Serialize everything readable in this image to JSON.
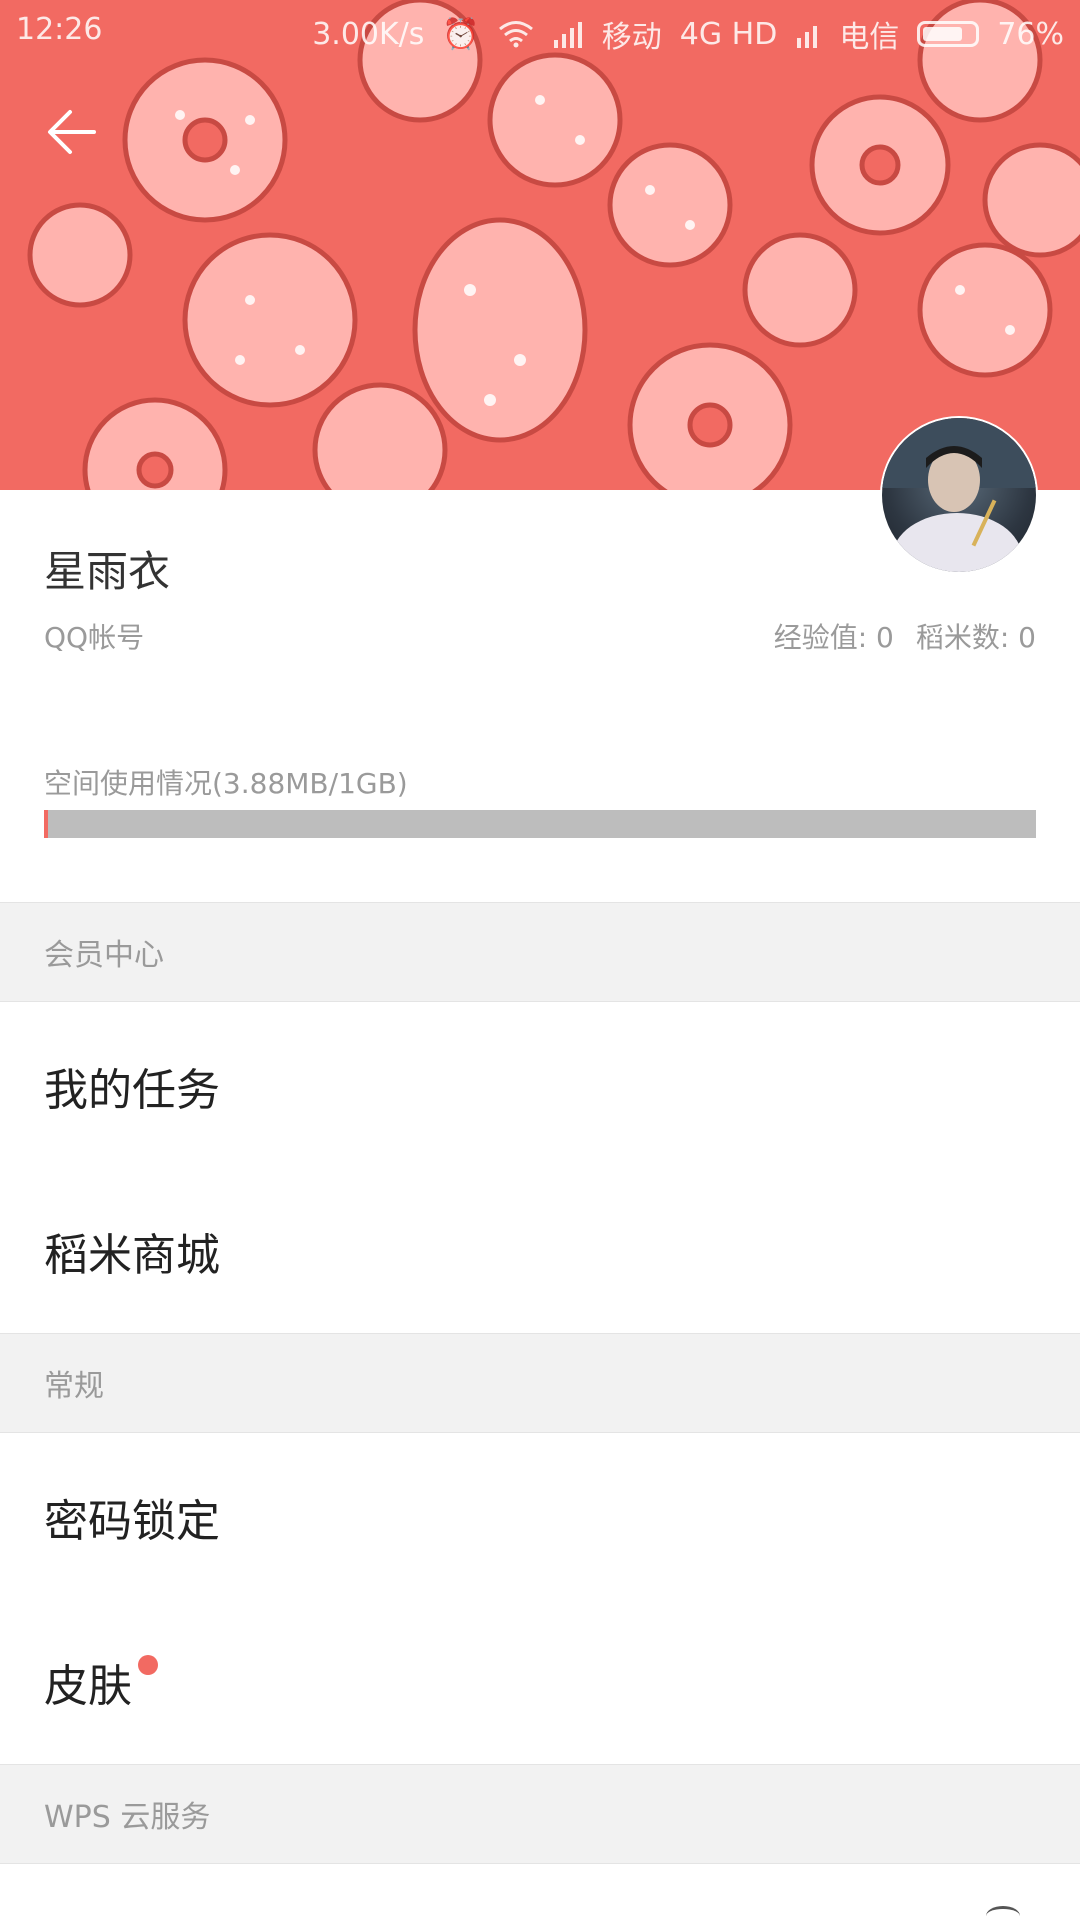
{
  "status_bar": {
    "time": "12:26",
    "speed": "3.00K/s",
    "carrier1": "移动",
    "network": "4G HD",
    "carrier2": "电信",
    "battery": "76%",
    "battery_level": 0.76
  },
  "header": {
    "back_icon": "arrow-left-icon",
    "accent_color": "#f26a62"
  },
  "profile": {
    "username": "星雨衣",
    "account_label": "QQ帐号",
    "experience": "经验值: 0",
    "rice_count": "稻米数: 0",
    "storage_label": "空间使用情况(3.88MB/1GB)",
    "storage_used_fraction": 0.0038
  },
  "sections": {
    "member": {
      "title": "会员中心",
      "items": [
        "我的任务",
        "稻米商城"
      ]
    },
    "general": {
      "title": "常规",
      "items": [
        "密码锁定",
        "皮肤"
      ]
    },
    "cloud": {
      "title": "WPS 云服务"
    }
  }
}
